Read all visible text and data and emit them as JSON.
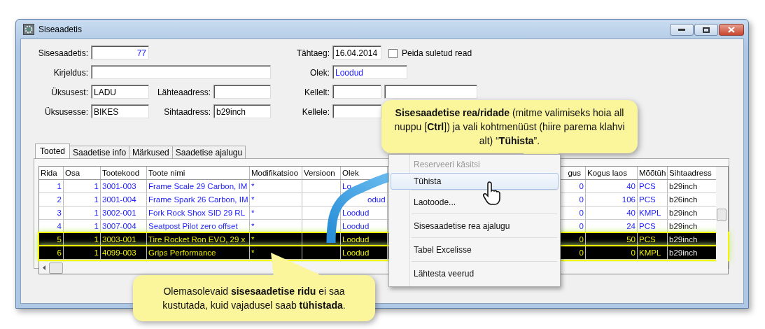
{
  "window": {
    "title": "Siseaadetis"
  },
  "form": {
    "number": {
      "label": "Sisesaadetis:",
      "value": "77"
    },
    "description": {
      "label": "Kirjeldus:"
    },
    "from_unit": {
      "label": "Üksusest:",
      "value": "LADU"
    },
    "source_address": {
      "label": "Lähteaadress:"
    },
    "to_unit": {
      "label": "Üksusesse:",
      "value": "BIKES"
    },
    "target_address": {
      "label": "Sihtaadress:",
      "value": "b29inch"
    },
    "due_date": {
      "label": "Tähtaeg:",
      "value": "16.04.2014"
    },
    "hide_closed": {
      "label": "Peida suletud read",
      "checked": false
    },
    "status": {
      "label": "Olek:",
      "value": "Loodud"
    },
    "from_person": {
      "label": "Kellelt:"
    },
    "to_person": {
      "label": "Kellele:"
    }
  },
  "tabs": [
    {
      "label": "Tooted",
      "selected": true
    },
    {
      "label": "Saadetise info",
      "selected": false
    },
    {
      "label": "Märkused",
      "selected": false
    },
    {
      "label": "Saadetise ajalugu",
      "selected": false
    }
  ],
  "table": {
    "columns": [
      "Rida",
      "Osa",
      "Tootekood",
      "Toote nimi",
      "Modifikatsioo",
      "Versioon",
      "Olek",
      "gus",
      "Kogus laos",
      "Mõõtüh",
      "Sihtaadress"
    ],
    "rows": [
      {
        "selected": false,
        "cells": [
          "1",
          "1",
          "3001-003",
          "Frame Scale 29 Carbon, IM",
          "*",
          "",
          "Lo",
          "0",
          "40",
          "PCS",
          "b29inch"
        ]
      },
      {
        "selected": false,
        "cells": [
          "2",
          "1",
          "3001-004",
          "Frame Spark 26 Carbon, IM",
          "*",
          "",
          "odud",
          "0",
          "106",
          "PCS",
          "b26inch"
        ]
      },
      {
        "selected": false,
        "cells": [
          "3",
          "1",
          "3002-001",
          "Fork Rock Shox SID 29 RL",
          "*",
          "",
          "Loodud",
          "0",
          "40",
          "KMPL",
          "b29inch"
        ]
      },
      {
        "selected": false,
        "cells": [
          "4",
          "1",
          "3007-004",
          "Seatpost Pilot zero offset",
          "*",
          "",
          "Loodud",
          "0",
          "24",
          "PCS",
          "b29inch"
        ]
      },
      {
        "selected": true,
        "cells": [
          "5",
          "1",
          "3003-001",
          "Tire Rocket Ron EVO, 29 x",
          "*",
          "",
          "Loodud",
          "0",
          "50",
          "PCS",
          "b29inch"
        ]
      },
      {
        "selected": true,
        "cells": [
          "6",
          "1",
          "4099-003",
          "Grips Performance",
          "*",
          "",
          "Loodud",
          "0",
          "0",
          "KMPL",
          "b29inch"
        ]
      }
    ]
  },
  "context_menu": [
    {
      "label": "Reserveeri käsitsi",
      "disabled": true,
      "selected": false
    },
    {
      "label": "Tühista",
      "disabled": false,
      "selected": true
    },
    {
      "label": "Laotoode...",
      "disabled": false,
      "selected": false
    },
    {
      "label": "Sisesaadetise rea ajalugu",
      "disabled": false,
      "selected": false
    },
    {
      "label": "Tabel Excelisse",
      "disabled": false,
      "selected": false
    },
    {
      "label": "Lähtesta veerud",
      "disabled": false,
      "selected": false
    }
  ],
  "callouts": [
    {
      "text": "**Sisesaadetise rea/ridade** (mitme valimiseks hoia all nuppu [**Ctrl**]) ja vali kohtmenüüst (hiire parema klahvi alt) “**Tühista**”."
    },
    {
      "text": "Olemasolevaid **sisesaadetise ridu** ei saa kustutada, kuid vajadusel saab **tühistada**."
    }
  ]
}
